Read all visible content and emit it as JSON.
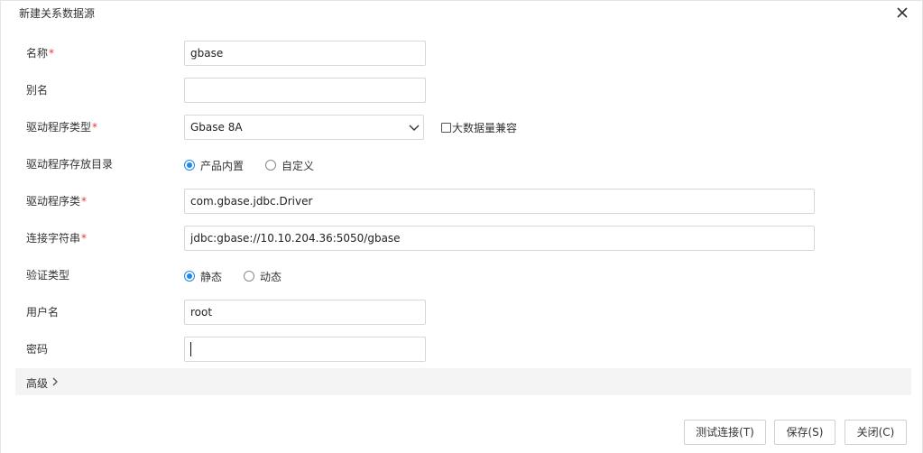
{
  "dialog": {
    "title": "新建关系数据源"
  },
  "form": {
    "name": {
      "label": "名称",
      "required_mark": "*",
      "value": "gbase"
    },
    "alias": {
      "label": "别名",
      "value": ""
    },
    "driver_type": {
      "label": "驱动程序类型",
      "required_mark": "*",
      "value": "Gbase 8A"
    },
    "big_data_compat": {
      "label": "大数据量兼容",
      "checked": false
    },
    "driver_dir": {
      "label": "驱动程序存放目录",
      "options": [
        "产品内置",
        "自定义"
      ],
      "selected": "产品内置"
    },
    "driver_class": {
      "label": "驱动程序类",
      "required_mark": "*",
      "value": "com.gbase.jdbc.Driver"
    },
    "conn_string": {
      "label": "连接字符串",
      "required_mark": "*",
      "value": "jdbc:gbase://10.10.204.36:5050/gbase"
    },
    "auth_type": {
      "label": "验证类型",
      "options": [
        "静态",
        "动态"
      ],
      "selected": "静态"
    },
    "username": {
      "label": "用户名",
      "value": "root"
    },
    "password": {
      "label": "密码",
      "value": ""
    }
  },
  "advanced": {
    "label": "高级"
  },
  "buttons": {
    "test": "测试连接(T)",
    "save": "保存(S)",
    "close": "关闭(C)"
  },
  "colors": {
    "accent": "#1e88e5",
    "required": "#e23b3b",
    "advanced_bg": "#f4f4f4"
  }
}
